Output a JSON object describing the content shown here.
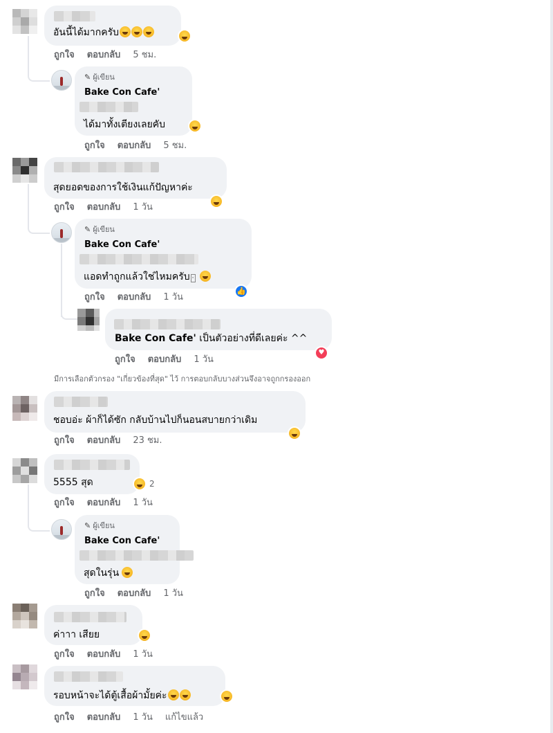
{
  "comments": [
    {
      "text": "อันนี้ได้มากครับ",
      "time": "5 ชม."
    },
    {
      "text": "สุดยอดของการใช้เงินแก้ปัญหาค่ะ",
      "time": "1 วัน"
    },
    {
      "text": "ชอบอ่ะ ผ้าก็ได้ซัก กลับบ้านไปก็นอนสบายกว่าเดิม",
      "time": "23 ชม."
    },
    {
      "text": "5555 สุด",
      "time": "1 วัน",
      "reaction_count": "2"
    },
    {
      "text": "ค่าาา เสียย",
      "time": "1 วัน"
    },
    {
      "text": "รอบหน้าจะได้ตู้เสื้อผ้ามั้ยค่ะ",
      "time": "1 วัน",
      "edited": "แก้ไขแล้ว"
    }
  ],
  "replies": [
    {
      "author_badge": "ผู้เขียน",
      "name": "Bake Con Cafe'",
      "text": "ได้มาทั้งเตียงเลยคับ",
      "time": "5 ชม."
    },
    {
      "author_badge": "ผู้เขียน",
      "name": "Bake Con Cafe'",
      "text": "แอดทำถูกแล้วใช่ไหมครับ",
      "time": "1 วัน"
    },
    {
      "author_badge": "ผู้เขียน",
      "name": "Bake Con Cafe'",
      "text": "สุดในรุ่น",
      "time": "1 วัน"
    }
  ],
  "nested_reply": {
    "mention": "Bake Con Cafe'",
    "text": " เป็นตัวอย่างที่ดีเลยค่ะ ^^",
    "time": "1 วัน"
  },
  "actions": {
    "like": "ถูกใจ",
    "reply": "ตอบกลับ"
  },
  "filter_notice": "มีการเลือกตัวกรอง \"เกี่ยวข้องที่สุด\" ไว้ การตอบกลับบางส่วนจึงอาจถูกกรองออก",
  "icons": {
    "pen": "pencil-icon",
    "like_reaction": "like-icon",
    "love_reaction": "heart-icon",
    "haha_reaction": "haha-emoji-icon"
  },
  "colors": {
    "bubble": "#f0f2f5",
    "meta": "#65676b",
    "text": "#050505",
    "like_blue": "#1877f2",
    "love_red": "#f33e58"
  }
}
